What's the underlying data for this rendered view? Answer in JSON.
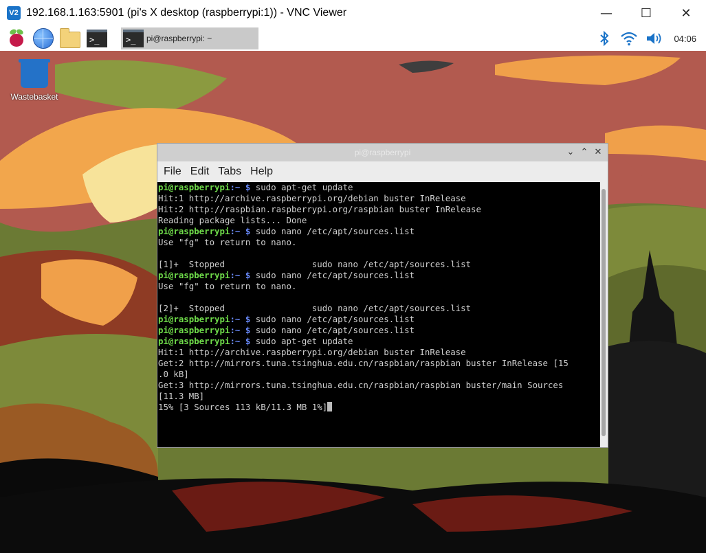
{
  "vnc": {
    "logo_text": "V2",
    "title": "192.168.1.163:5901 (pi's X desktop (raspberrypi:1)) - VNC Viewer",
    "minimize": "—",
    "maximize": "☐",
    "close": "✕"
  },
  "taskbar": {
    "terminal_glyph": ">_",
    "task_button_label": "pi@raspberrypi: ~",
    "clock": "04:06"
  },
  "desktop": {
    "wastebasket_label": "Wastebasket"
  },
  "terminal": {
    "title": "pi@raspberrypi",
    "menu": [
      "File",
      "Edit",
      "Tabs",
      "Help"
    ],
    "prompt_user": "pi@raspberrypi",
    "prompt_path": ":~ $ ",
    "lines": [
      {
        "kind": "prompt",
        "cmd": "sudo apt-get update"
      },
      {
        "kind": "out",
        "text": "Hit:1 http://archive.raspberrypi.org/debian buster InRelease"
      },
      {
        "kind": "out",
        "text": "Hit:2 http://raspbian.raspberrypi.org/raspbian buster InRelease"
      },
      {
        "kind": "out",
        "text": "Reading package lists... Done"
      },
      {
        "kind": "prompt",
        "cmd": "sudo nano /etc/apt/sources.list"
      },
      {
        "kind": "out",
        "text": "Use \"fg\" to return to nano."
      },
      {
        "kind": "out",
        "text": ""
      },
      {
        "kind": "out",
        "text": "[1]+  Stopped                 sudo nano /etc/apt/sources.list"
      },
      {
        "kind": "prompt",
        "cmd": "sudo nano /etc/apt/sources.list"
      },
      {
        "kind": "out",
        "text": "Use \"fg\" to return to nano."
      },
      {
        "kind": "out",
        "text": ""
      },
      {
        "kind": "out",
        "text": "[2]+  Stopped                 sudo nano /etc/apt/sources.list"
      },
      {
        "kind": "prompt",
        "cmd": "sudo nano /etc/apt/sources.list"
      },
      {
        "kind": "prompt",
        "cmd": "sudo nano /etc/apt/sources.list"
      },
      {
        "kind": "prompt",
        "cmd": "sudo apt-get update"
      },
      {
        "kind": "out",
        "text": "Hit:1 http://archive.raspberrypi.org/debian buster InRelease"
      },
      {
        "kind": "out",
        "text": "Get:2 http://mirrors.tuna.tsinghua.edu.cn/raspbian/raspbian buster InRelease [15"
      },
      {
        "kind": "out",
        "text": ".0 kB]"
      },
      {
        "kind": "out",
        "text": "Get:3 http://mirrors.tuna.tsinghua.edu.cn/raspbian/raspbian buster/main Sources"
      },
      {
        "kind": "out",
        "text": "[11.3 MB]"
      },
      {
        "kind": "out",
        "text": "15% [3 Sources 113 kB/11.3 MB 1%]",
        "cursor": true
      }
    ]
  }
}
